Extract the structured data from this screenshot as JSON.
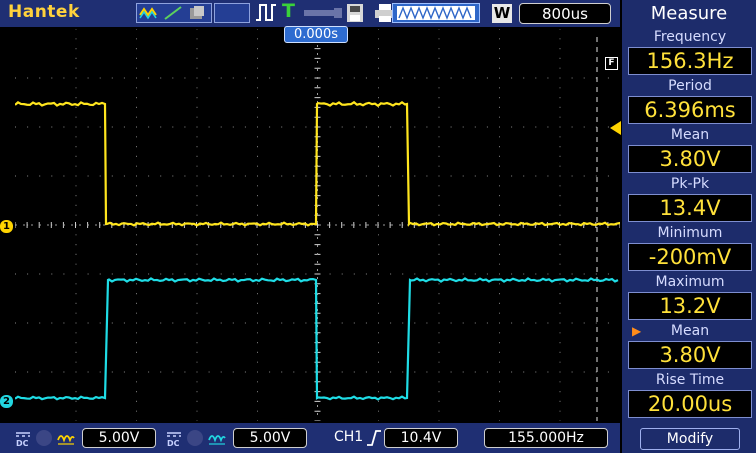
{
  "header": {
    "brand": "Hantek",
    "timebase": "800us",
    "w_badge": "W",
    "trigger_status": "T"
  },
  "scope": {
    "trigger_position": "0.000s",
    "ch1_marker": "1",
    "ch2_marker": "2",
    "f_marker": "F",
    "colors": {
      "ch1": "#ffe51e",
      "ch2": "#1fdde6",
      "grid": "#6e6e6e",
      "trigger": "#ffd400"
    }
  },
  "measure": {
    "title": "Measure",
    "items": [
      {
        "label": "Frequency",
        "value": "156.3Hz",
        "selected": false
      },
      {
        "label": "Period",
        "value": "6.396ms",
        "selected": false
      },
      {
        "label": "Mean",
        "value": "3.80V",
        "selected": false
      },
      {
        "label": "Pk-Pk",
        "value": "13.4V",
        "selected": false
      },
      {
        "label": "Minimum",
        "value": "-200mV",
        "selected": false
      },
      {
        "label": "Maximum",
        "value": "13.2V",
        "selected": false
      },
      {
        "label": "Mean",
        "value": "3.80V",
        "selected": true
      },
      {
        "label": "Rise Time",
        "value": "20.00us",
        "selected": false
      }
    ],
    "modify_label": "Modify"
  },
  "footer": {
    "ch1_volts": "5.00V",
    "ch2_volts": "5.00V",
    "trigger_channel": "CH1",
    "trigger_level": "10.4V",
    "trigger_frequency": "155.000Hz"
  }
}
